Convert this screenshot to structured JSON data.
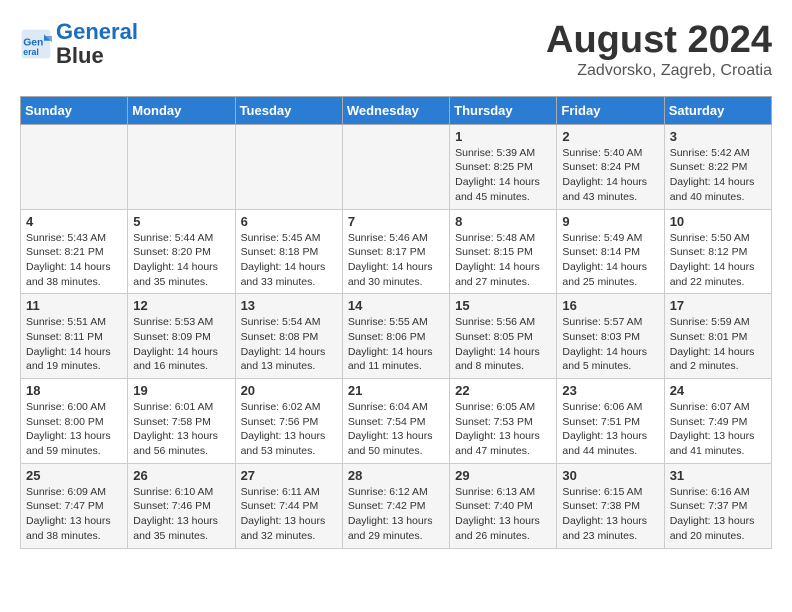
{
  "header": {
    "logo_line1": "General",
    "logo_line2": "Blue",
    "month_year": "August 2024",
    "location": "Zadvorsko, Zagreb, Croatia"
  },
  "weekdays": [
    "Sunday",
    "Monday",
    "Tuesday",
    "Wednesday",
    "Thursday",
    "Friday",
    "Saturday"
  ],
  "weeks": [
    [
      {
        "day": "",
        "info": ""
      },
      {
        "day": "",
        "info": ""
      },
      {
        "day": "",
        "info": ""
      },
      {
        "day": "",
        "info": ""
      },
      {
        "day": "1",
        "info": "Sunrise: 5:39 AM\nSunset: 8:25 PM\nDaylight: 14 hours\nand 45 minutes."
      },
      {
        "day": "2",
        "info": "Sunrise: 5:40 AM\nSunset: 8:24 PM\nDaylight: 14 hours\nand 43 minutes."
      },
      {
        "day": "3",
        "info": "Sunrise: 5:42 AM\nSunset: 8:22 PM\nDaylight: 14 hours\nand 40 minutes."
      }
    ],
    [
      {
        "day": "4",
        "info": "Sunrise: 5:43 AM\nSunset: 8:21 PM\nDaylight: 14 hours\nand 38 minutes."
      },
      {
        "day": "5",
        "info": "Sunrise: 5:44 AM\nSunset: 8:20 PM\nDaylight: 14 hours\nand 35 minutes."
      },
      {
        "day": "6",
        "info": "Sunrise: 5:45 AM\nSunset: 8:18 PM\nDaylight: 14 hours\nand 33 minutes."
      },
      {
        "day": "7",
        "info": "Sunrise: 5:46 AM\nSunset: 8:17 PM\nDaylight: 14 hours\nand 30 minutes."
      },
      {
        "day": "8",
        "info": "Sunrise: 5:48 AM\nSunset: 8:15 PM\nDaylight: 14 hours\nand 27 minutes."
      },
      {
        "day": "9",
        "info": "Sunrise: 5:49 AM\nSunset: 8:14 PM\nDaylight: 14 hours\nand 25 minutes."
      },
      {
        "day": "10",
        "info": "Sunrise: 5:50 AM\nSunset: 8:12 PM\nDaylight: 14 hours\nand 22 minutes."
      }
    ],
    [
      {
        "day": "11",
        "info": "Sunrise: 5:51 AM\nSunset: 8:11 PM\nDaylight: 14 hours\nand 19 minutes."
      },
      {
        "day": "12",
        "info": "Sunrise: 5:53 AM\nSunset: 8:09 PM\nDaylight: 14 hours\nand 16 minutes."
      },
      {
        "day": "13",
        "info": "Sunrise: 5:54 AM\nSunset: 8:08 PM\nDaylight: 14 hours\nand 13 minutes."
      },
      {
        "day": "14",
        "info": "Sunrise: 5:55 AM\nSunset: 8:06 PM\nDaylight: 14 hours\nand 11 minutes."
      },
      {
        "day": "15",
        "info": "Sunrise: 5:56 AM\nSunset: 8:05 PM\nDaylight: 14 hours\nand 8 minutes."
      },
      {
        "day": "16",
        "info": "Sunrise: 5:57 AM\nSunset: 8:03 PM\nDaylight: 14 hours\nand 5 minutes."
      },
      {
        "day": "17",
        "info": "Sunrise: 5:59 AM\nSunset: 8:01 PM\nDaylight: 14 hours\nand 2 minutes."
      }
    ],
    [
      {
        "day": "18",
        "info": "Sunrise: 6:00 AM\nSunset: 8:00 PM\nDaylight: 13 hours\nand 59 minutes."
      },
      {
        "day": "19",
        "info": "Sunrise: 6:01 AM\nSunset: 7:58 PM\nDaylight: 13 hours\nand 56 minutes."
      },
      {
        "day": "20",
        "info": "Sunrise: 6:02 AM\nSunset: 7:56 PM\nDaylight: 13 hours\nand 53 minutes."
      },
      {
        "day": "21",
        "info": "Sunrise: 6:04 AM\nSunset: 7:54 PM\nDaylight: 13 hours\nand 50 minutes."
      },
      {
        "day": "22",
        "info": "Sunrise: 6:05 AM\nSunset: 7:53 PM\nDaylight: 13 hours\nand 47 minutes."
      },
      {
        "day": "23",
        "info": "Sunrise: 6:06 AM\nSunset: 7:51 PM\nDaylight: 13 hours\nand 44 minutes."
      },
      {
        "day": "24",
        "info": "Sunrise: 6:07 AM\nSunset: 7:49 PM\nDaylight: 13 hours\nand 41 minutes."
      }
    ],
    [
      {
        "day": "25",
        "info": "Sunrise: 6:09 AM\nSunset: 7:47 PM\nDaylight: 13 hours\nand 38 minutes."
      },
      {
        "day": "26",
        "info": "Sunrise: 6:10 AM\nSunset: 7:46 PM\nDaylight: 13 hours\nand 35 minutes."
      },
      {
        "day": "27",
        "info": "Sunrise: 6:11 AM\nSunset: 7:44 PM\nDaylight: 13 hours\nand 32 minutes."
      },
      {
        "day": "28",
        "info": "Sunrise: 6:12 AM\nSunset: 7:42 PM\nDaylight: 13 hours\nand 29 minutes."
      },
      {
        "day": "29",
        "info": "Sunrise: 6:13 AM\nSunset: 7:40 PM\nDaylight: 13 hours\nand 26 minutes."
      },
      {
        "day": "30",
        "info": "Sunrise: 6:15 AM\nSunset: 7:38 PM\nDaylight: 13 hours\nand 23 minutes."
      },
      {
        "day": "31",
        "info": "Sunrise: 6:16 AM\nSunset: 7:37 PM\nDaylight: 13 hours\nand 20 minutes."
      }
    ]
  ]
}
